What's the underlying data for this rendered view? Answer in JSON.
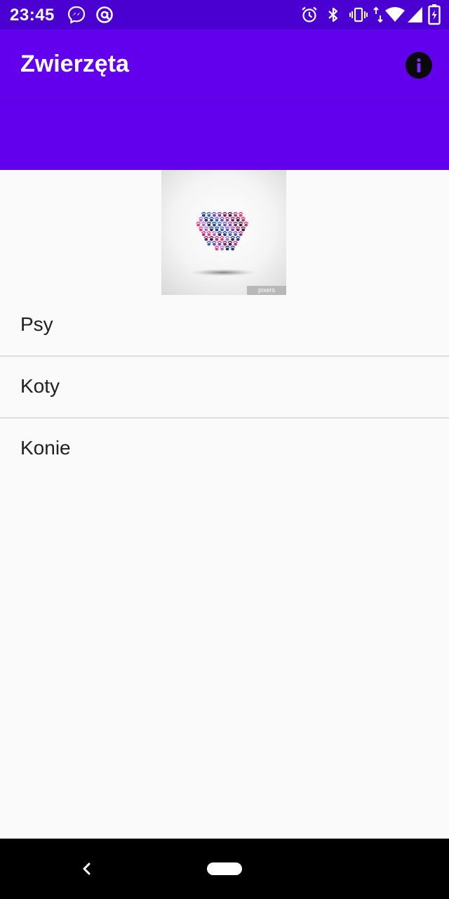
{
  "status_bar": {
    "time": "23:45",
    "left_icons": [
      "messenger-icon",
      "at-sign-icon"
    ],
    "right_icons": [
      "alarm-icon",
      "bluetooth-icon",
      "vibrate-icon",
      "data-arrows-icon",
      "wifi-icon",
      "signal-icon",
      "battery-charging-icon"
    ]
  },
  "app_bar": {
    "title": "Zwierzęta",
    "action_icon": "info-icon"
  },
  "hero": {
    "image": "paw-print-heart",
    "watermark_text": "pixers"
  },
  "list": {
    "items": [
      {
        "label": "Psy"
      },
      {
        "label": "Koty"
      },
      {
        "label": "Konie"
      }
    ]
  },
  "nav_bar": {
    "back_icon": "chevron-left-icon",
    "home_icon": "home-pill-icon"
  },
  "colors": {
    "status_bar": "#4a00d0",
    "app_bar": "#6200ee",
    "background": "#fafafa",
    "divider": "#dcdcdc",
    "text": "#212121"
  }
}
